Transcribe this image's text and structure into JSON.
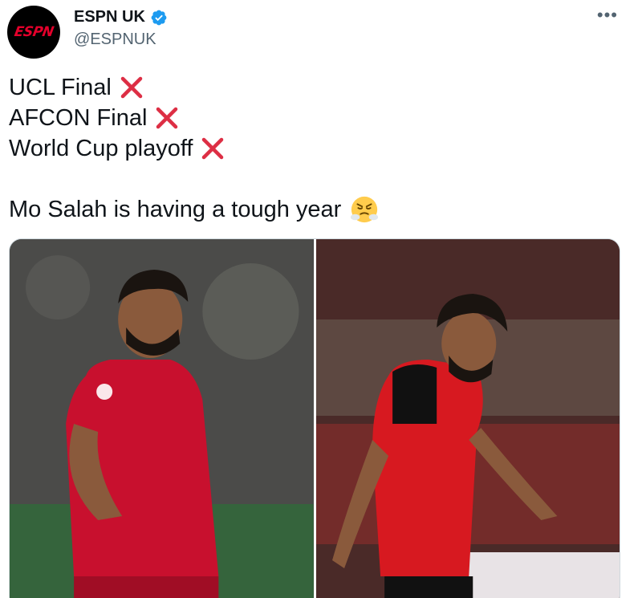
{
  "author": {
    "display_name": "ESPN UK",
    "handle": "@ESPNUK",
    "avatar_text": "ESPN",
    "verified": true
  },
  "menu": {
    "more_label": "•••"
  },
  "tweet": {
    "lines": [
      {
        "text": "UCL Final",
        "icon": "cross-mark-icon"
      },
      {
        "text": "AFCON Final",
        "icon": "cross-mark-icon"
      },
      {
        "text": "World Cup playoff",
        "icon": "cross-mark-icon"
      },
      {
        "text": "Mo Salah is having a tough year",
        "icon": "face-with-steam-icon"
      }
    ]
  },
  "colors": {
    "cross": "#dd2e44",
    "verified": "#1d9bf0",
    "brand_red": "#e4002b"
  }
}
